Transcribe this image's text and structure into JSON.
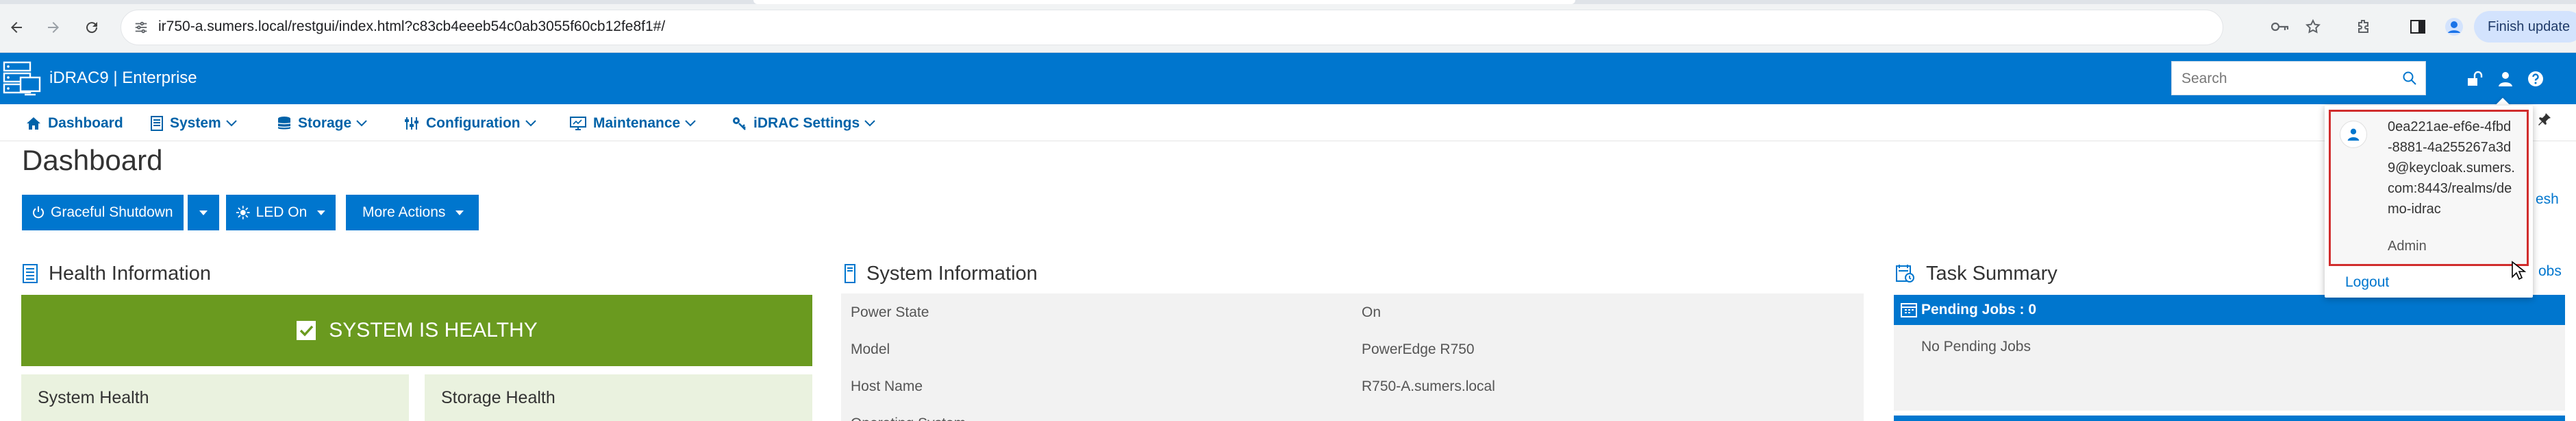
{
  "browser": {
    "url": "ir750-a.sumers.local/restgui/index.html?c83cb4eeeb54c0ab3055f60cb12fe8f1#/",
    "update_button": "Finish update"
  },
  "header": {
    "title": "iDRAC9 | Enterprise",
    "search_placeholder": "Search"
  },
  "nav": {
    "items": [
      {
        "label": "Dashboard",
        "icon": "home-icon"
      },
      {
        "label": "System",
        "icon": "server-icon"
      },
      {
        "label": "Storage",
        "icon": "database-icon"
      },
      {
        "label": "Configuration",
        "icon": "sliders-icon"
      },
      {
        "label": "Maintenance",
        "icon": "monitor-icon"
      },
      {
        "label": "iDRAC Settings",
        "icon": "key-gear-icon"
      }
    ]
  },
  "page": {
    "title": "Dashboard"
  },
  "actions": {
    "shutdown": "Graceful Shutdown",
    "led": "LED On",
    "more": "More Actions"
  },
  "health": {
    "heading": "Health Information",
    "banner": "SYSTEM IS HEALTHY",
    "cards": [
      "System Health",
      "Storage Health"
    ]
  },
  "system_info": {
    "heading": "System Information",
    "rows": [
      {
        "key": "Power State",
        "value": "On"
      },
      {
        "key": "Model",
        "value": "PowerEdge R750"
      },
      {
        "key": "Host Name",
        "value": "R750-A.sumers.local"
      },
      {
        "key": "Operating System",
        "value": ""
      }
    ]
  },
  "tasks": {
    "heading": "Task Summary",
    "pending_header": "Pending Jobs : 0",
    "pending_empty": "No Pending Jobs"
  },
  "edge_links": {
    "refresh_fragment": "esh",
    "jobs_fragment": "obs"
  },
  "user_menu": {
    "username": "0ea221ae-ef6e-4fbd-8881-4a255267a3d9@keycloak.sumers.com:8443/realms/demo-idrac",
    "role": "Admin",
    "logout": "Logout"
  },
  "colors": {
    "brand_blue": "#0076ce",
    "nav_blue": "#0062a8",
    "healthy_green": "#6a9a1f",
    "highlight_red": "#d12d2d"
  }
}
